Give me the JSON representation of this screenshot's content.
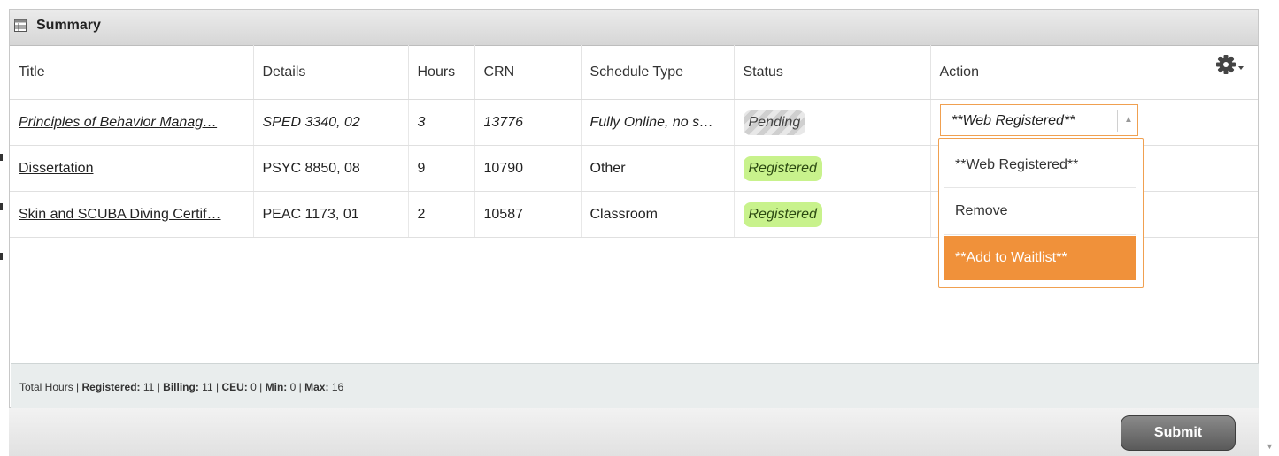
{
  "panel": {
    "title": "Summary",
    "icon": "table-icon"
  },
  "columns": [
    "Title",
    "Details",
    "Hours",
    "CRN",
    "Schedule Type",
    "Status",
    "Action"
  ],
  "rows": [
    {
      "title": "Principles of Behavior Manag…",
      "details": "SPED 3340, 02",
      "hours": "3",
      "crn": "13776",
      "schedule_type": "Fully Online, no s…",
      "status": "Pending"
    },
    {
      "title": "Dissertation",
      "details": "PSYC 8850, 08",
      "hours": "9",
      "crn": "10790",
      "schedule_type": "Other",
      "status": "Registered"
    },
    {
      "title": "Skin and SCUBA Diving Certif…",
      "details": "PEAC 1173, 01",
      "hours": "2",
      "crn": "10587",
      "schedule_type": "Classroom",
      "status": "Registered"
    }
  ],
  "action_select": {
    "value": "**Web Registered**",
    "options": [
      "**Web Registered**",
      "Remove",
      "**Add to Waitlist**"
    ],
    "highlighted": "**Add to Waitlist**"
  },
  "totals": {
    "prefix": "Total Hours |",
    "registered_label": "Registered:",
    "registered": "11",
    "billing_label": "Billing:",
    "billing": "11",
    "ceu_label": "CEU:",
    "ceu": "0",
    "min_label": "Min:",
    "min": "0",
    "max_label": "Max:",
    "max": "16",
    "sep": "|"
  },
  "submit_label": "Submit",
  "icons": {
    "settings": "gear-icon",
    "scroll": "scroll-down-icon"
  },
  "colors": {
    "accent_orange": "#f0913a",
    "registered_badge": "#c8f28c",
    "submit_button": "#6e6e6e"
  }
}
